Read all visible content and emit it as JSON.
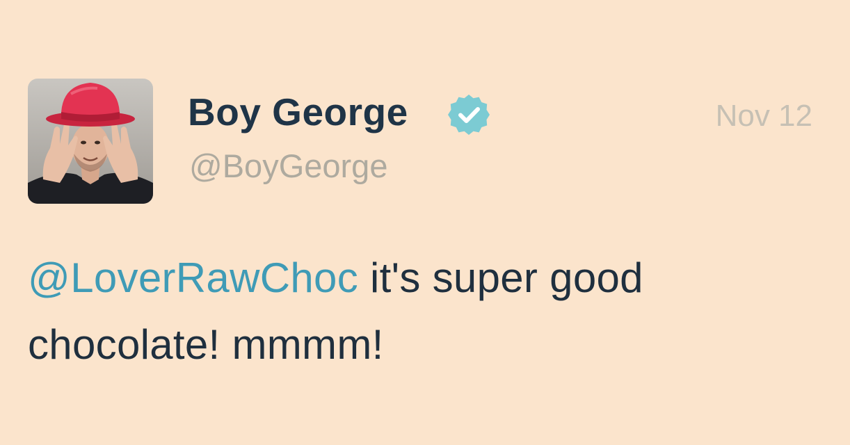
{
  "tweet": {
    "avatar_icon": "profile-avatar-man-red-hat",
    "display_name": "Boy George",
    "verified_icon": "verified-badge-icon",
    "handle": "@BoyGeorge",
    "timestamp": "Nov 12",
    "mention": "@LoverRawChoc",
    "text_line1": " it's super good",
    "text_line2": "chocolate! mmmm!"
  },
  "colors": {
    "background": "#fbe4cc",
    "name": "#1f3447",
    "handle": "#aeaa9f",
    "timestamp": "#c6c0b4",
    "mention": "#3f9bb6",
    "body_text": "#1f2f3e",
    "verified": "#7ccbd3"
  }
}
